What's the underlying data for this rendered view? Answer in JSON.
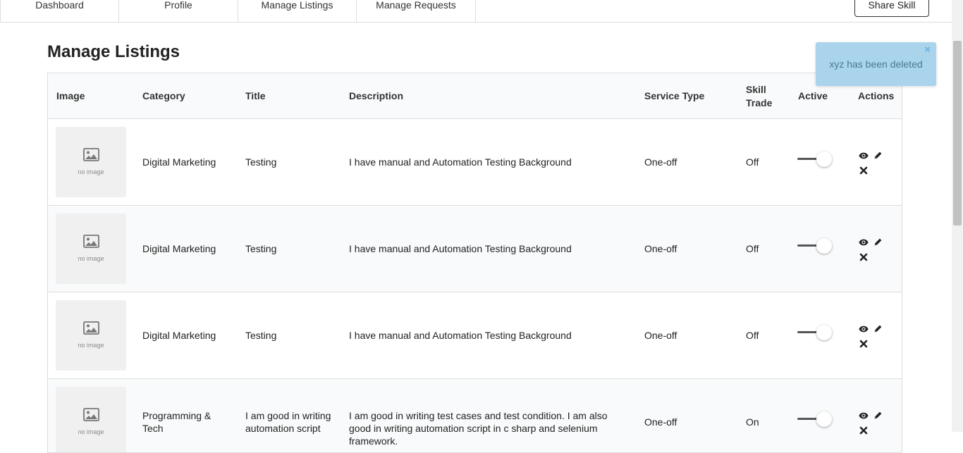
{
  "nav": {
    "tabs": [
      {
        "label": "Dashboard"
      },
      {
        "label": "Profile"
      },
      {
        "label": "Manage Listings"
      },
      {
        "label": "Manage Requests"
      }
    ],
    "share_label": "Share Skill"
  },
  "page_title": "Manage Listings",
  "table": {
    "headers": {
      "image": "Image",
      "category": "Category",
      "title": "Title",
      "description": "Description",
      "service_type": "Service Type",
      "skill_trade": "Skill Trade",
      "active": "Active",
      "actions": "Actions"
    },
    "no_image_label": "no image",
    "rows": [
      {
        "category": "Digital Marketing",
        "title": "Testing",
        "description": "I have manual and Automation Testing Background",
        "service_type": "One-off",
        "skill_trade": "Off"
      },
      {
        "category": "Digital Marketing",
        "title": "Testing",
        "description": "I have manual and Automation Testing Background",
        "service_type": "One-off",
        "skill_trade": "Off"
      },
      {
        "category": "Digital Marketing",
        "title": "Testing",
        "description": "I have manual and Automation Testing Background",
        "service_type": "One-off",
        "skill_trade": "Off"
      },
      {
        "category": "Programming & Tech",
        "title": "I am good in writing automation script",
        "description": "I am good in writing test cases and test condition. I am also good in writing automation script in c sharp and selenium framework.",
        "service_type": "One-off",
        "skill_trade": "On"
      }
    ]
  },
  "toast": {
    "message": "xyz has been deleted",
    "close": "×"
  },
  "icons": {
    "view": "eye-icon",
    "edit": "pencil-icon",
    "delete": "close-icon",
    "image_placeholder": "image-icon"
  }
}
